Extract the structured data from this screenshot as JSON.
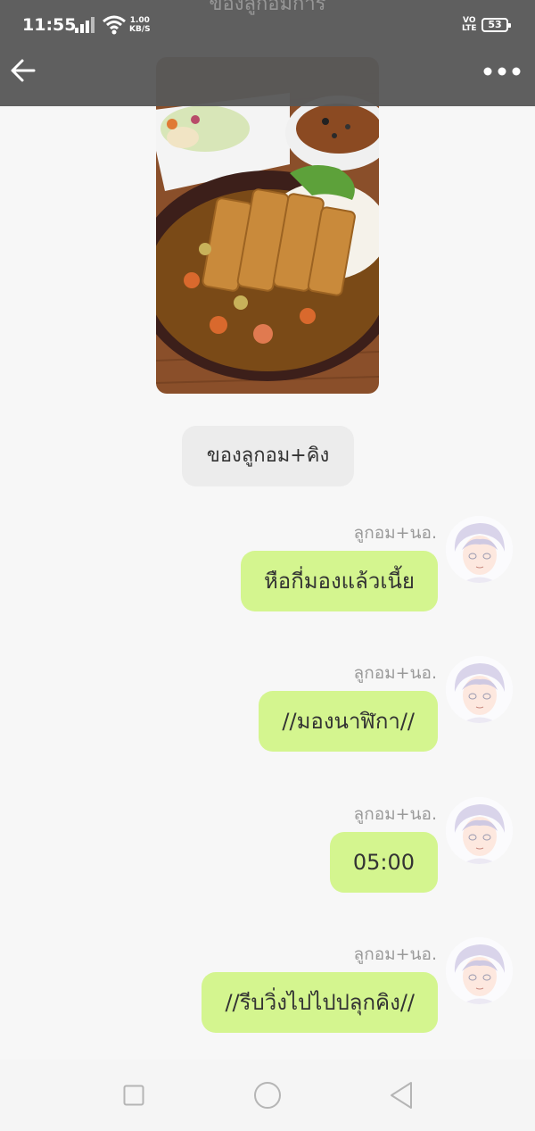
{
  "status_bar": {
    "time": "11:55",
    "net_speed_value": "1.00",
    "net_speed_unit": "KB/S",
    "volte_top": "VO",
    "volte_bottom": "LTE",
    "battery": "53"
  },
  "header": {
    "peek_text": "ของลูกอมการ"
  },
  "note": {
    "text": "ของลูกอม+คิง"
  },
  "messages": [
    {
      "sender": "ลูกอม+นอ.",
      "text": "หือกี่มองแล้วเนี้ย"
    },
    {
      "sender": "ลูกอม+นอ.",
      "text": "//มองนาฬิกา//"
    },
    {
      "sender": "ลูกอม+นอ.",
      "text": "05:00"
    },
    {
      "sender": "ลูกอม+นอ.",
      "text": "//รีบวิ่งไปไปปลุกคิง//"
    }
  ],
  "colors": {
    "outgoing_bubble": "#d4f58f",
    "note_bubble": "#ececec",
    "header_overlay": "#585858"
  },
  "icons": {
    "back": "arrow-left-icon",
    "more": "more-dots-icon",
    "nav_recent": "square-icon",
    "nav_home": "circle-icon",
    "nav_back": "triangle-back-icon"
  }
}
